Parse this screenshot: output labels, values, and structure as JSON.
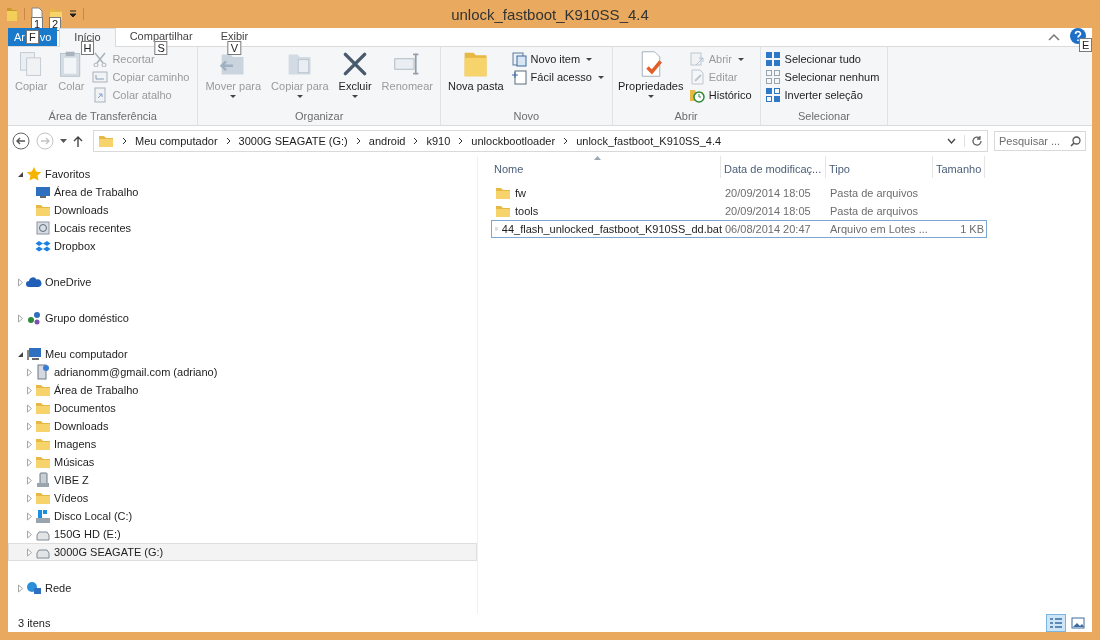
{
  "window": {
    "title": "unlock_fastboot_K910SS_4.4"
  },
  "quick_access": {
    "keytips": [
      "1",
      "2"
    ]
  },
  "ribbon_tabs": [
    {
      "kind": "file",
      "label_parts": [
        "Ar",
        "vo"
      ],
      "keytip": "F",
      "selected": false
    },
    {
      "kind": "tab",
      "label": "Início",
      "keytip": "H",
      "selected": true
    },
    {
      "kind": "tab",
      "label": "Compartilhar",
      "keytip": "S",
      "selected": false
    },
    {
      "kind": "tab",
      "label": "Exibir",
      "keytip": "V",
      "selected": false
    }
  ],
  "help": {
    "keytip": "E"
  },
  "ribbon_groups": [
    {
      "label": "Área de Transferência",
      "buttons": [
        {
          "kind": "large",
          "label": "Copiar",
          "disabled": true,
          "dropdown": false
        },
        {
          "kind": "large",
          "label": "Colar",
          "disabled": true,
          "dropdown": false
        },
        {
          "kind": "small",
          "label": "Recortar",
          "disabled": true,
          "dropdown": false
        },
        {
          "kind": "small",
          "label": "Copiar caminho",
          "disabled": true,
          "dropdown": false
        },
        {
          "kind": "small",
          "label": "Colar atalho",
          "disabled": true,
          "dropdown": false
        }
      ]
    },
    {
      "label": "Organizar",
      "buttons": [
        {
          "kind": "large",
          "label": "Mover para",
          "disabled": true,
          "dropdown": true
        },
        {
          "kind": "large",
          "label": "Copiar para",
          "disabled": true,
          "dropdown": true
        },
        {
          "kind": "large",
          "label": "Excluir",
          "disabled": false,
          "dropdown": true
        },
        {
          "kind": "large",
          "label": "Renomear",
          "disabled": true,
          "dropdown": false
        }
      ]
    },
    {
      "label": "Novo",
      "buttons": [
        {
          "kind": "large",
          "label": "Nova pasta",
          "disabled": false,
          "dropdown": false
        },
        {
          "kind": "small",
          "label": "Novo item",
          "disabled": false,
          "dropdown": true
        },
        {
          "kind": "small",
          "label": "Fácil acesso",
          "disabled": false,
          "dropdown": true
        }
      ]
    },
    {
      "label": "Abrir",
      "buttons": [
        {
          "kind": "large",
          "label": "Propriedades",
          "disabled": false,
          "dropdown": true
        },
        {
          "kind": "small",
          "label": "Abrir",
          "disabled": true,
          "dropdown": true
        },
        {
          "kind": "small",
          "label": "Editar",
          "disabled": true,
          "dropdown": false
        },
        {
          "kind": "small",
          "label": "Histórico",
          "disabled": false,
          "dropdown": false
        }
      ]
    },
    {
      "label": "Selecionar",
      "buttons": [
        {
          "kind": "small",
          "label": "Selecionar tudo",
          "disabled": false,
          "dropdown": false
        },
        {
          "kind": "small",
          "label": "Selecionar nenhum",
          "disabled": false,
          "dropdown": false
        },
        {
          "kind": "small",
          "label": "Inverter seleção",
          "disabled": false,
          "dropdown": false
        }
      ]
    }
  ],
  "address_bar": {
    "back": {
      "disabled": false
    },
    "forward": {
      "disabled": true
    },
    "breadcrumbs": [
      "Meu computador",
      "3000G SEAGATE (G:)",
      "android",
      "k910",
      "unlockbootloader",
      "unlock_fastboot_K910SS_4.4"
    ]
  },
  "search": {
    "placeholder": "Pesquisar ..."
  },
  "navigation_pane": [
    {
      "kind": "star",
      "label": "Favoritos",
      "expanded": true,
      "selected": false,
      "children": [
        {
          "kind": "desktop",
          "label": "Área de Trabalho",
          "selected": false
        },
        {
          "kind": "folder",
          "label": "Downloads",
          "selected": false
        },
        {
          "kind": "recent",
          "label": "Locais recentes",
          "selected": false
        },
        {
          "kind": "dropbox",
          "label": "Dropbox",
          "selected": false
        }
      ]
    },
    {
      "kind": "cloud",
      "label": "OneDrive",
      "expanded": false,
      "selected": false
    },
    {
      "kind": "homegroup",
      "label": "Grupo doméstico",
      "expanded": false,
      "selected": false
    },
    {
      "kind": "computer",
      "label": "Meu computador",
      "expanded": true,
      "selected": false,
      "children": [
        {
          "kind": "netdrive",
          "label": "adrianomm@gmail.com (adriano)",
          "expanded": false,
          "selected": false
        },
        {
          "kind": "folder",
          "label": "Área de Trabalho",
          "expanded": false,
          "selected": false
        },
        {
          "kind": "folder",
          "label": "Documentos",
          "expanded": false,
          "selected": false
        },
        {
          "kind": "folder",
          "label": "Downloads",
          "expanded": false,
          "selected": false
        },
        {
          "kind": "folder",
          "label": "Imagens",
          "expanded": false,
          "selected": false
        },
        {
          "kind": "folder",
          "label": "Músicas",
          "expanded": false,
          "selected": false
        },
        {
          "kind": "phone",
          "label": "VIBE Z",
          "expanded": false,
          "selected": false
        },
        {
          "kind": "folder",
          "label": "Vídeos",
          "expanded": false,
          "selected": false
        },
        {
          "kind": "sysdrive",
          "label": "Disco Local (C:)",
          "expanded": false,
          "selected": false
        },
        {
          "kind": "drive",
          "label": "150G HD (E:)",
          "expanded": false,
          "selected": false
        },
        {
          "kind": "drive",
          "label": "3000G SEAGATE (G:)",
          "expanded": false,
          "selected": true
        }
      ]
    },
    {
      "kind": "network",
      "label": "Rede",
      "expanded": false,
      "selected": false
    }
  ],
  "file_list": {
    "columns": [
      {
        "label": "Nome",
        "sorted": true
      },
      {
        "label": "Data de modificaç...",
        "sorted": false
      },
      {
        "label": "Tipo",
        "sorted": false
      },
      {
        "label": "Tamanho",
        "sorted": false
      }
    ],
    "rows": [
      {
        "kind": "folder",
        "name": "fw",
        "date": "20/09/2014 18:05",
        "type": "Pasta de arquivos",
        "focused": false
      },
      {
        "kind": "folder",
        "name": "tools",
        "date": "20/09/2014 18:05",
        "type": "Pasta de arquivos",
        "focused": false
      },
      {
        "kind": "file",
        "name": "44_flash_unlocked_fastboot_K910SS_dd.bat",
        "date": "06/08/2014 20:47",
        "type": "Arquivo em Lotes ...",
        "size": "1 KB",
        "focused": true
      }
    ]
  },
  "status_bar": {
    "text": "3 itens",
    "views": [
      {
        "kind": "details",
        "selected": true
      },
      {
        "kind": "large-icons",
        "selected": false
      }
    ]
  }
}
